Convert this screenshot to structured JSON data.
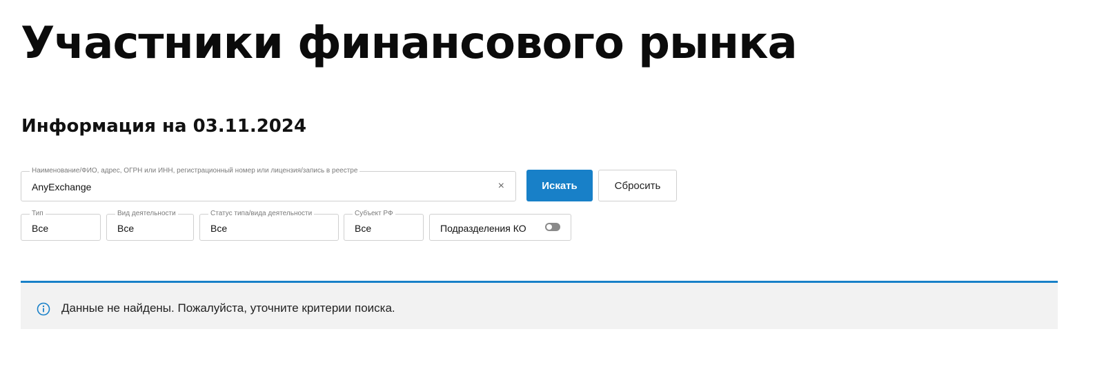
{
  "page": {
    "title": "Участники финансового рынка",
    "subtitle": "Информация на 03.11.2024"
  },
  "search": {
    "legend": "Наименование/ФИО, адрес, ОГРН или ИНН, регистрационный номер или лицензия/запись в реестре",
    "value": "AnyExchange",
    "clear_icon": "close-icon",
    "search_button": "Искать",
    "reset_button": "Сбросить"
  },
  "filters": {
    "type": {
      "legend": "Тип",
      "value": "Все"
    },
    "activity": {
      "legend": "Вид деятельности",
      "value": "Все"
    },
    "status": {
      "legend": "Статус типа/вида деятельности",
      "value": "Все"
    },
    "subject": {
      "legend": "Субъект РФ",
      "value": "Все"
    },
    "ko_divisions": {
      "label": "Подразделения КО",
      "enabled": false
    }
  },
  "notice": {
    "icon": "info-icon",
    "text": "Данные не найдены. Пожалуйста, уточните критерии поиска."
  },
  "colors": {
    "accent": "#1880c8",
    "notice_bg": "#f2f2f2",
    "border": "#cfcfcf"
  }
}
